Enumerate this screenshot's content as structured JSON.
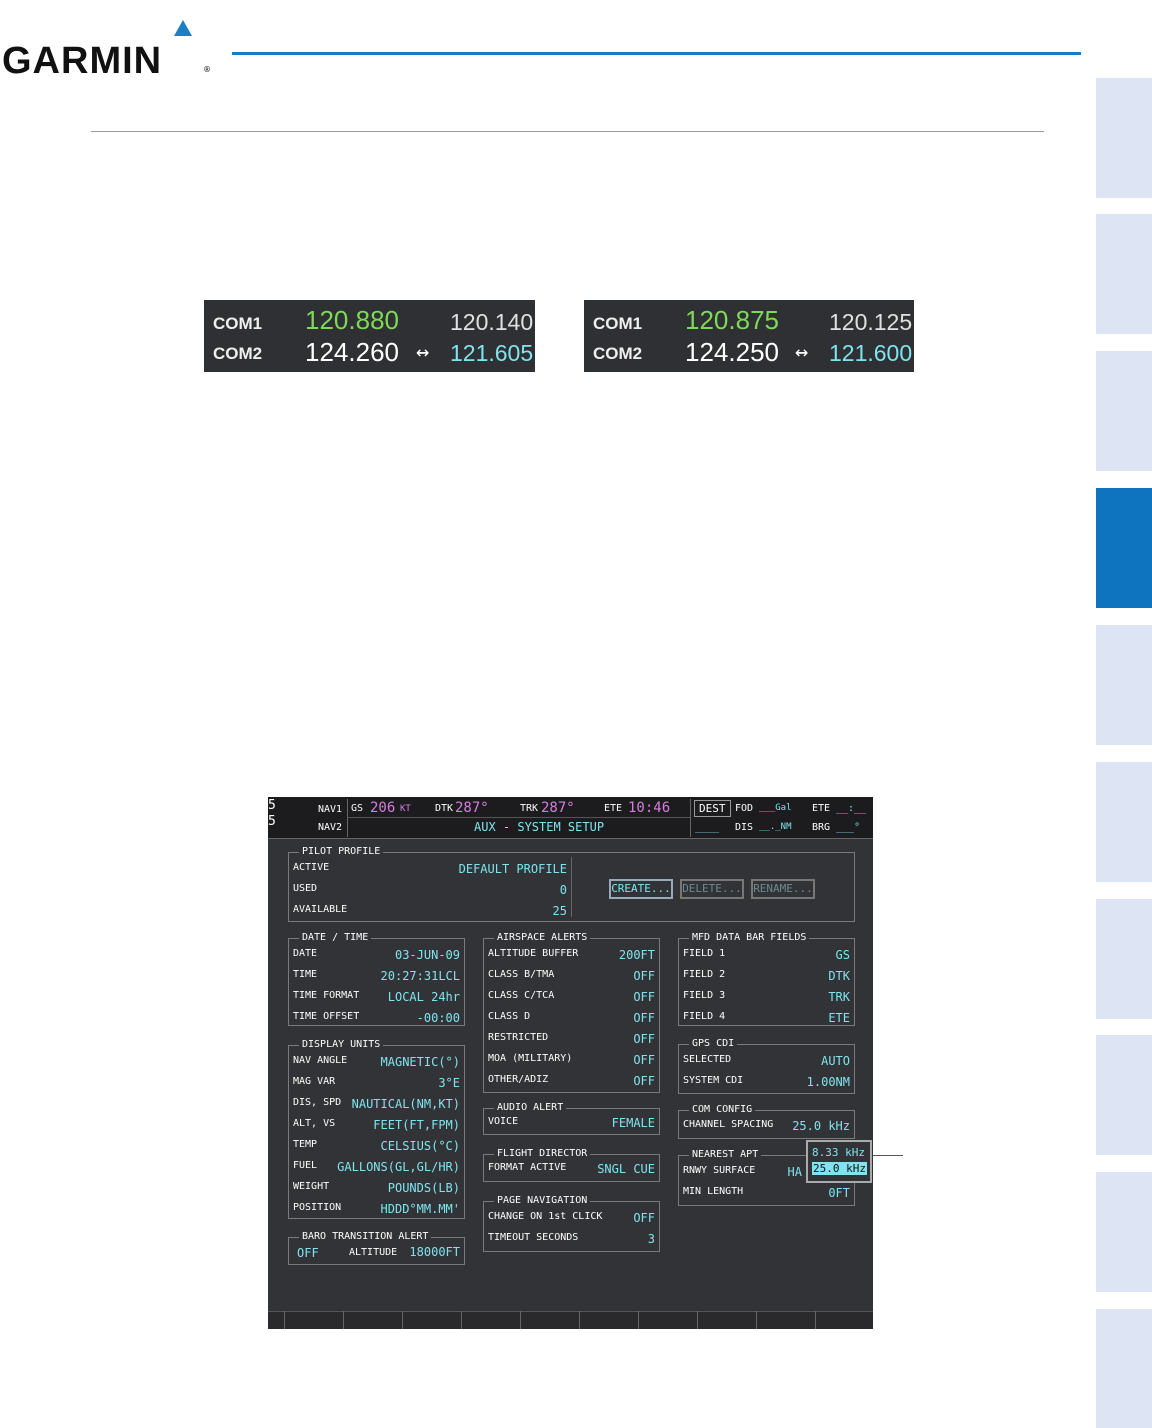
{
  "brand": {
    "name": "GARMIN",
    "reg": "®"
  },
  "com_displays": [
    {
      "com1_label": "COM1",
      "com1_active": "120.880",
      "com1_standby": "120.140",
      "com2_label": "COM2",
      "com2_active": "124.260",
      "arrow": "↔",
      "com2_standby": "121.605"
    },
    {
      "com1_label": "COM1",
      "com1_active": "120.875",
      "com1_standby": "120.125",
      "com2_label": "COM2",
      "com2_active": "124.250",
      "arrow": "↔",
      "com2_standby": "121.600"
    }
  ],
  "mfd": {
    "edge_digits": [
      "5",
      "5"
    ],
    "top": {
      "nav1": "NAV1",
      "nav2": "NAV2",
      "gs_label": "GS",
      "gs_value": "206",
      "gs_unit": "KT",
      "dtk_label": "DTK",
      "dtk_value": "287°",
      "trk_label": "TRK",
      "trk_value": "287°",
      "ete_label": "ETE",
      "ete_value": "10:46",
      "dest": "DEST",
      "fod_label": "FOD",
      "fod_value": "___Gal",
      "ete2_label": "ETE",
      "ete2_value": "__:__",
      "dash4": "____",
      "dis_label": "DIS",
      "dis_value": "__._NM",
      "brg_label": "BRG",
      "brg_value": "___°",
      "page_title": "AUX - SYSTEM SETUP"
    },
    "pilot_profile": {
      "title": "PILOT PROFILE",
      "active_label": "ACTIVE",
      "active_value": "DEFAULT PROFILE",
      "used_label": "USED",
      "used_value": "0",
      "available_label": "AVAILABLE",
      "available_value": "25",
      "create": "CREATE...",
      "delete": "DELETE...",
      "rename": "RENAME..."
    },
    "date_time": {
      "title": "DATE / TIME",
      "rows": [
        {
          "k": "DATE",
          "v": "03-JUN-09"
        },
        {
          "k": "TIME",
          "v": "20:27:31LCL"
        },
        {
          "k": "TIME FORMAT",
          "v": "LOCAL 24hr"
        },
        {
          "k": "TIME OFFSET",
          "v": "-00:00"
        }
      ]
    },
    "display_units": {
      "title": "DISPLAY UNITS",
      "rows": [
        {
          "k": "NAV ANGLE",
          "v": "MAGNETIC(°)"
        },
        {
          "k": "MAG VAR",
          "v": "3°E"
        },
        {
          "k": "DIS, SPD",
          "v": "NAUTICAL(NM,KT)"
        },
        {
          "k": "ALT, VS",
          "v": "FEET(FT,FPM)"
        },
        {
          "k": "TEMP",
          "v": "CELSIUS(°C)"
        },
        {
          "k": "FUEL",
          "v": "GALLONS(GL,GL/HR)"
        },
        {
          "k": "WEIGHT",
          "v": "POUNDS(LB)"
        },
        {
          "k": "POSITION",
          "v": "HDDD°MM.MM'"
        }
      ]
    },
    "baro": {
      "title": "BARO TRANSITION ALERT",
      "state": "OFF",
      "alt_label": "ALTITUDE",
      "alt_value": "18000FT"
    },
    "airspace": {
      "title": "AIRSPACE ALERTS",
      "rows": [
        {
          "k": "ALTITUDE BUFFER",
          "v": "200FT"
        },
        {
          "k": "CLASS B/TMA",
          "v": "OFF"
        },
        {
          "k": "CLASS C/TCA",
          "v": "OFF"
        },
        {
          "k": "CLASS D",
          "v": "OFF"
        },
        {
          "k": "RESTRICTED",
          "v": "OFF"
        },
        {
          "k": "MOA (MILITARY)",
          "v": "OFF"
        },
        {
          "k": "OTHER/ADIZ",
          "v": "OFF"
        }
      ]
    },
    "audio": {
      "title": "AUDIO ALERT",
      "k": "VOICE",
      "v": "FEMALE"
    },
    "flight_director": {
      "title": "FLIGHT DIRECTOR",
      "k": "FORMAT ACTIVE",
      "v": "SNGL CUE"
    },
    "page_nav": {
      "title": "PAGE NAVIGATION",
      "k1": "CHANGE ON 1st CLICK",
      "v1": "OFF",
      "k2": "TIMEOUT SECONDS",
      "v2": "3"
    },
    "mfd_fields": {
      "title": "MFD DATA BAR FIELDS",
      "rows": [
        {
          "k": "FIELD 1",
          "v": "GS"
        },
        {
          "k": "FIELD 2",
          "v": "DTK"
        },
        {
          "k": "FIELD 3",
          "v": "TRK"
        },
        {
          "k": "FIELD 4",
          "v": "ETE"
        }
      ]
    },
    "gps_cdi": {
      "title": "GPS CDI",
      "k1": "SELECTED",
      "v1": "AUTO",
      "k2": "SYSTEM CDI",
      "v2": "1.00NM"
    },
    "com_config": {
      "title": "COM CONFIG",
      "k": "CHANNEL SPACING",
      "v": "25.0 kHz"
    },
    "nearest_apt": {
      "title": "NEAREST APT",
      "k1": "RNWY SURFACE",
      "v1": "HA",
      "k2": "MIN LENGTH",
      "v2": "0FT"
    },
    "popup": {
      "opt1": "8.33 kHz",
      "opt2": "25.0 kHz"
    }
  }
}
